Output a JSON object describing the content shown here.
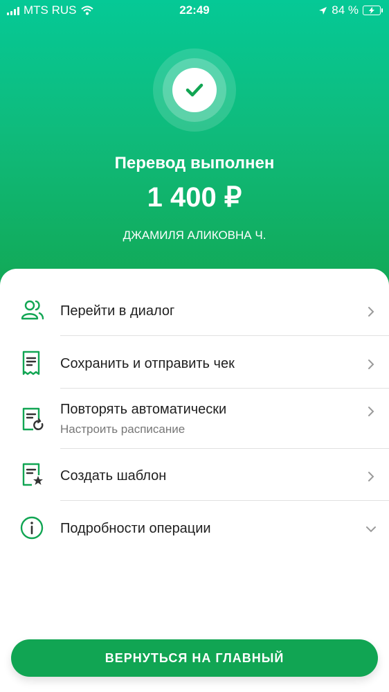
{
  "status_bar": {
    "carrier": "MTS RUS",
    "time": "22:49",
    "battery": "84 %"
  },
  "header": {
    "title": "Перевод выполнен",
    "amount": "1 400 ₽",
    "recipient": "ДЖАМИЛЯ АЛИКОВНА Ч."
  },
  "actions": {
    "dialog": {
      "label": "Перейти в диалог"
    },
    "receipt": {
      "label": "Сохранить и отправить чек"
    },
    "repeat": {
      "label": "Повторять автоматически",
      "sub": "Настроить расписание"
    },
    "template": {
      "label": "Создать шаблон"
    },
    "details": {
      "label": "Подробности операции"
    }
  },
  "button": {
    "label": "ВЕРНУТЬСЯ НА ГЛАВНЫЙ"
  },
  "colors": {
    "accent": "#11a553",
    "header_top": "#05c996",
    "header_bottom": "#12a855"
  }
}
